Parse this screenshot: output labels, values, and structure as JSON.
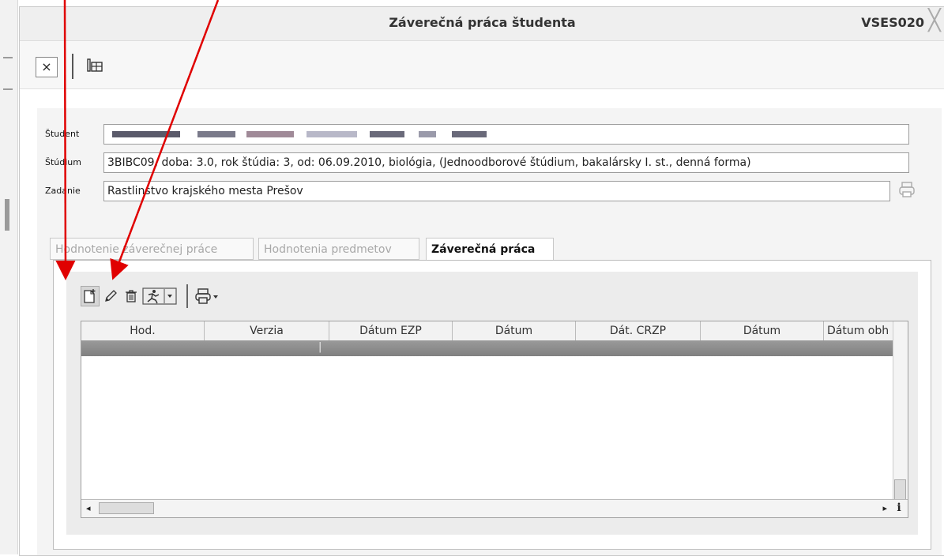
{
  "window": {
    "title": "Záverečná práca študenta",
    "code": "VSES020",
    "close_glyph": "╳"
  },
  "toolbar": {
    "close_glyph": "×"
  },
  "form": {
    "student_label": "Študent",
    "studium_label": "Štúdium",
    "studium_value": "3BIBC09, doba: 3.0, rok štúdia: 3, od: 06.09.2010, biológia, (Jednoodborové štúdium, bakalársky I. st., denná forma)",
    "zadanie_label": "Zadanie",
    "zadanie_value": "Rastlinstvo krajského mesta Prešov"
  },
  "tabs": [
    {
      "label": "Hodnotenie záverečnej práce",
      "state": "disabled"
    },
    {
      "label": "Hodnotenia predmetov",
      "state": "disabled"
    },
    {
      "label": "Záverečná práca",
      "state": "active"
    }
  ],
  "grid": {
    "columns": [
      "Hod.",
      "Verzia",
      "Dátum EZP",
      "Dátum",
      "Dát. CRZP",
      "Dátum",
      "Dátum obh"
    ],
    "row_marker": "|",
    "scroll_left": "◂",
    "scroll_right": "▸",
    "info": "i"
  },
  "icons": {
    "new": "new-record-icon",
    "edit": "pencil-icon",
    "delete": "trash-icon",
    "actions": "runner-dropdown-icon",
    "print": "printer-dropdown-icon"
  },
  "colors": {
    "annotation": "#e00000",
    "selected_row": "#8a8a8a"
  }
}
